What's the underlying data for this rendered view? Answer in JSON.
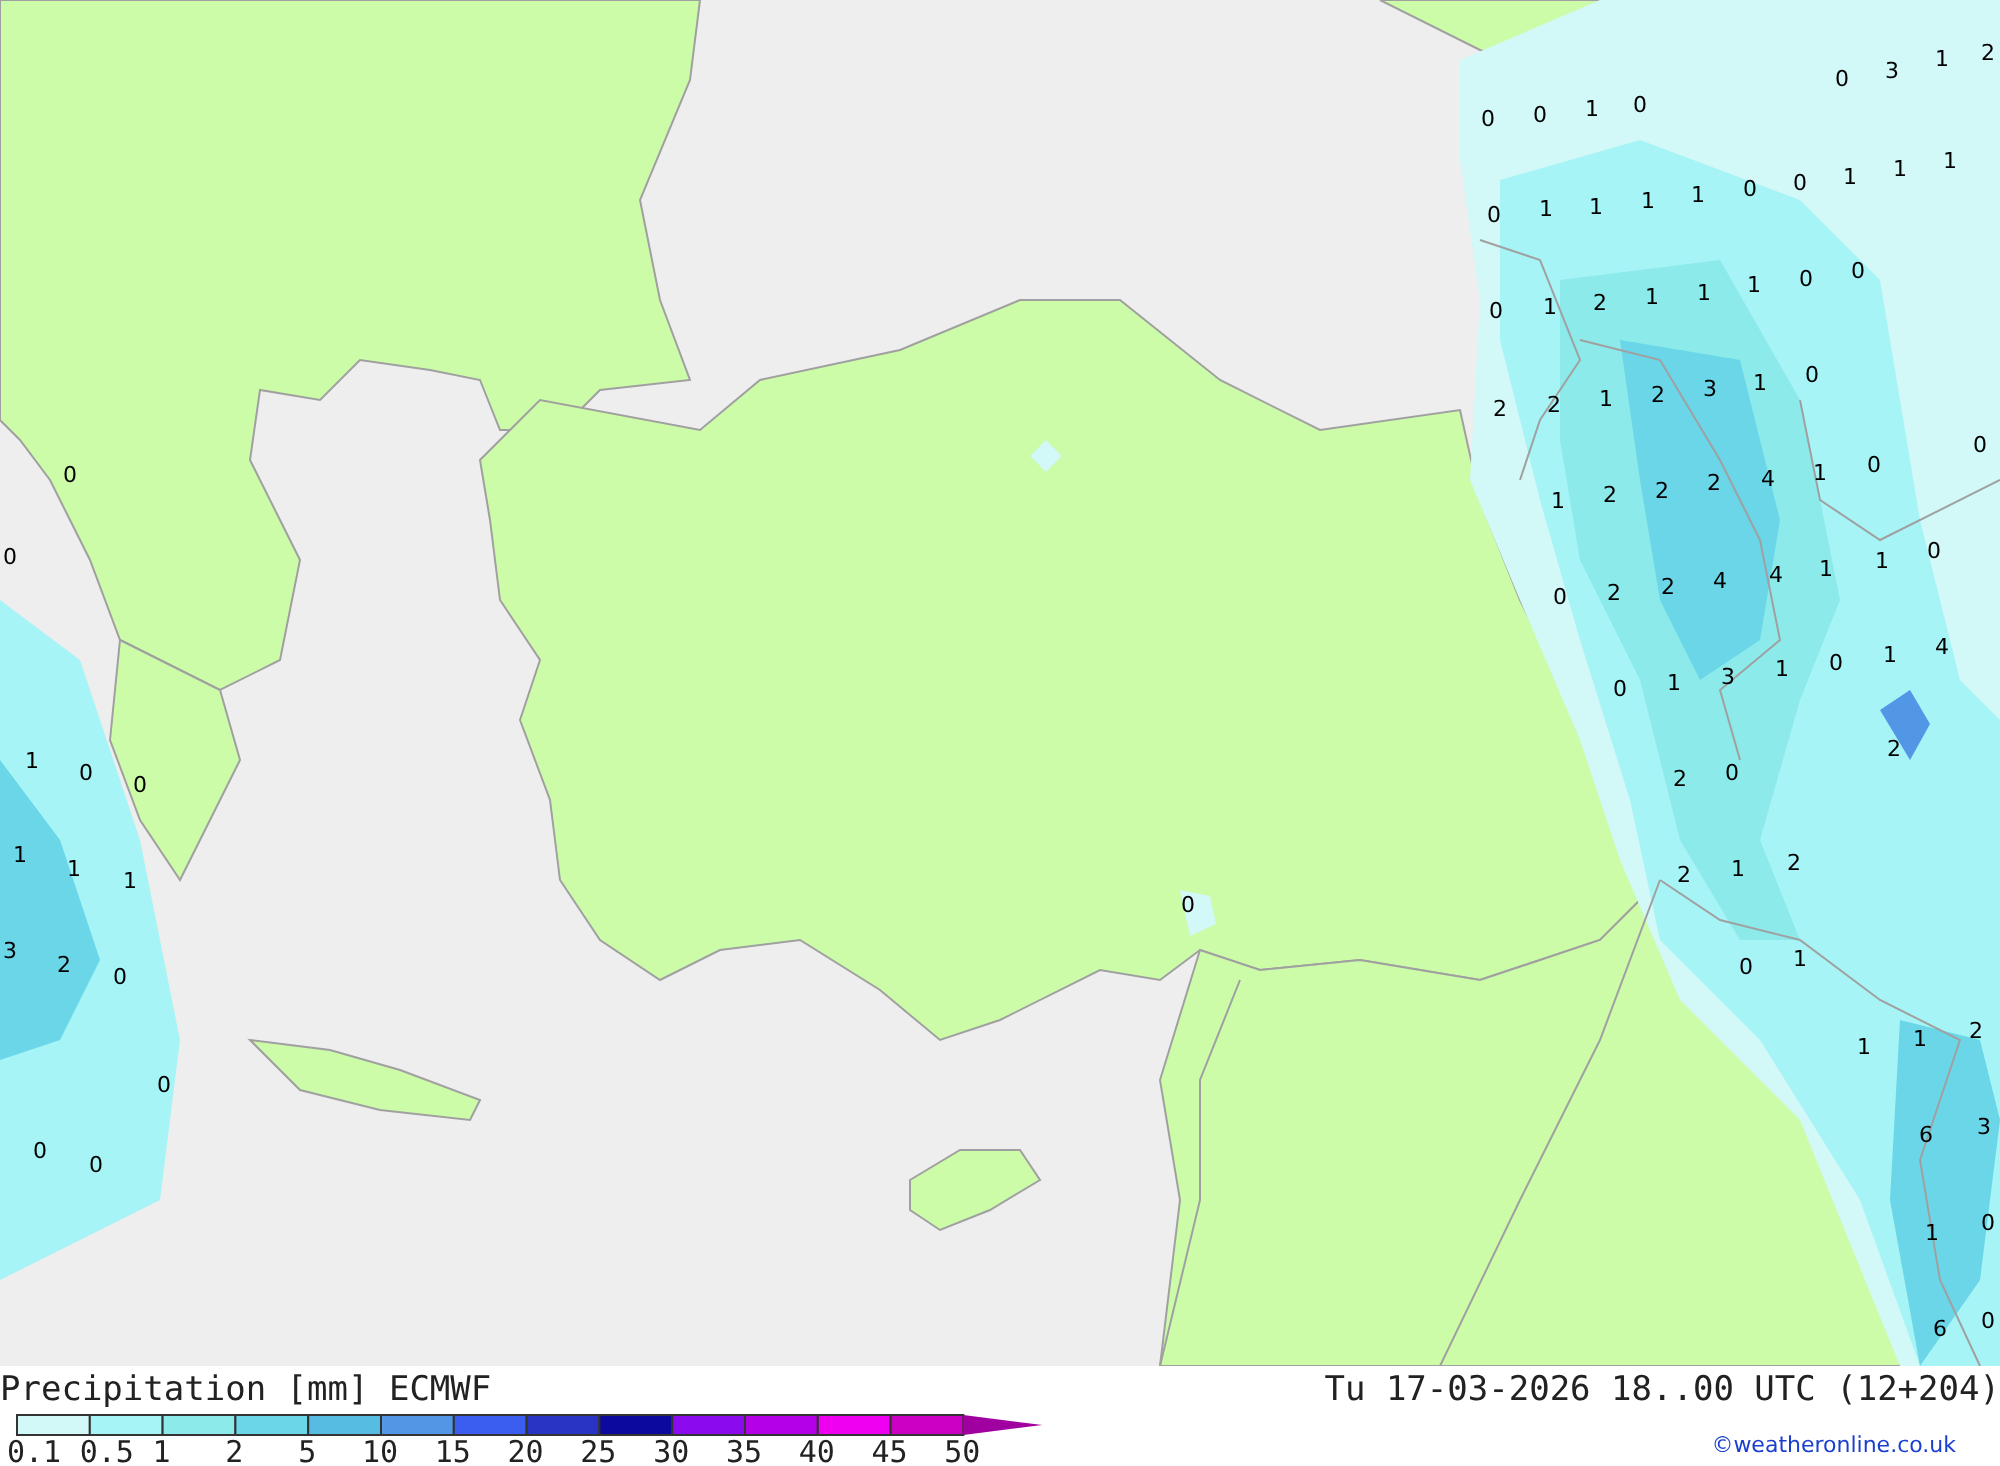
{
  "map": {
    "values": [
      "0",
      "3",
      "1",
      "2",
      "0",
      "0",
      "1",
      "0",
      "0",
      "1",
      "1",
      "1",
      "1",
      "0",
      "0",
      "1",
      "1",
      "1",
      "0",
      "1",
      "2",
      "1",
      "1",
      "1",
      "0",
      "0",
      "2",
      "2",
      "1",
      "2",
      "3",
      "1",
      "0",
      "0",
      "1",
      "2",
      "2",
      "2",
      "4",
      "1",
      "0",
      "0",
      "2",
      "2",
      "4",
      "4",
      "1",
      "1",
      "0",
      "0",
      "1",
      "3",
      "1",
      "0",
      "1",
      "4",
      "2",
      "2",
      "0",
      "2",
      "1",
      "2",
      "0",
      "1",
      "1",
      "1",
      "2",
      "6",
      "3",
      "1",
      "0",
      "6",
      "0",
      "0",
      "0",
      "1",
      "0",
      "0",
      "1",
      "1",
      "1",
      "3",
      "2",
      "0",
      "0",
      "0",
      "0",
      "0"
    ]
  },
  "legend": {
    "title": "Precipitation [mm] ECMWF",
    "items": [
      {
        "label": "0.1",
        "color": "#d2f8f8"
      },
      {
        "label": "0.5",
        "color": "#a6f4f6"
      },
      {
        "label": "1",
        "color": "#8ceaea"
      },
      {
        "label": "2",
        "color": "#6ad6e8"
      },
      {
        "label": "5",
        "color": "#56bce2"
      },
      {
        "label": "10",
        "color": "#5296e6"
      },
      {
        "label": "15",
        "color": "#3c5ef0"
      },
      {
        "label": "20",
        "color": "#2a34c4"
      },
      {
        "label": "25",
        "color": "#0c0a9e"
      },
      {
        "label": "30",
        "color": "#8c0aee"
      },
      {
        "label": "35",
        "color": "#b400e6"
      },
      {
        "label": "40",
        "color": "#f000f0"
      },
      {
        "label": "45",
        "color": "#cc00c4"
      },
      {
        "label": "50",
        "color": "#a000a0"
      }
    ]
  },
  "valid_time": "Tu 17-03-2026 18..00 UTC (12+204)",
  "credit": "©weatheronline.co.uk"
}
